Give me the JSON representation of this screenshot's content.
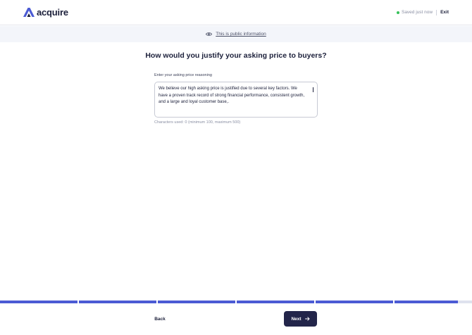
{
  "header": {
    "logo_text": "acquire",
    "saved_status": "Saved just now",
    "exit_label": "Exit",
    "status_color": "#36c15a"
  },
  "banner": {
    "icon": "eye-icon",
    "text": "This is public information"
  },
  "main": {
    "question": "How would you justify your asking price to buyers?",
    "field_label": "Enter your asking price reasoning",
    "textarea_value": "We believe our high asking price is justified due to several key factors. We have a proven track record of strong financial performance, consistent growth, and a large and loyal customer base,.",
    "char_count": "Characters used: 0 (minimum 100, maximum 500)"
  },
  "progress": {
    "segments": [
      1,
      1,
      1,
      1,
      1,
      0.82
    ],
    "fill_color": "#4b5bd4"
  },
  "footer": {
    "back_label": "Back",
    "next_label": "Next",
    "next_icon": "arrow-right-icon"
  }
}
